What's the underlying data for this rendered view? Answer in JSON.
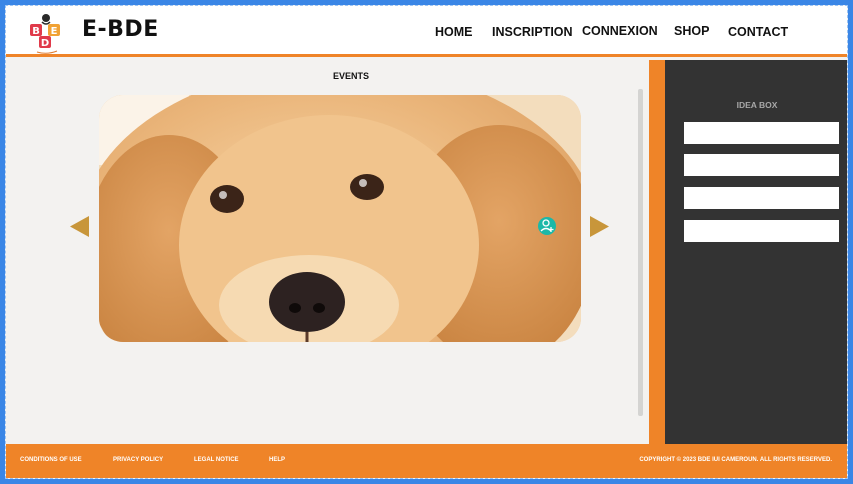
{
  "brand": {
    "logo_icon": "bde-logo-icon",
    "name": "E-BDE"
  },
  "nav": {
    "items": [
      {
        "label": "HOME"
      },
      {
        "label": "INSCRIPTION"
      },
      {
        "label": "CONNEXION"
      },
      {
        "label": "SHOP"
      },
      {
        "label": "CONTACT"
      }
    ]
  },
  "main": {
    "section_title": "EVENTS",
    "carousel": {
      "image_subject": "golden-retriever-puppy",
      "prev_icon": "triangle-left-icon",
      "next_icon": "triangle-right-icon",
      "floating_icon": "person-add-icon"
    }
  },
  "sidebar": {
    "title": "IDEA BOX",
    "fields": [
      {
        "placeholder": "",
        "value": ""
      },
      {
        "placeholder": "",
        "value": ""
      },
      {
        "placeholder": "",
        "value": ""
      },
      {
        "placeholder": "",
        "value": ""
      }
    ]
  },
  "footer": {
    "links": [
      {
        "label": "CONDITIONS OF USE"
      },
      {
        "label": "PRIVACY POLICY"
      },
      {
        "label": "LEGAL NOTICE"
      },
      {
        "label": "HELP"
      }
    ],
    "copyright": "COPYRIGHT © 2023 BDE IUI CAMEROUN. ALL RIGHTS RESERVED."
  },
  "colors": {
    "accent": "#ef8428",
    "sidebar_bg": "#333333",
    "page_bg": "#f3f2f0",
    "arrow": "#c8963a",
    "frame": "#3a86e6"
  }
}
